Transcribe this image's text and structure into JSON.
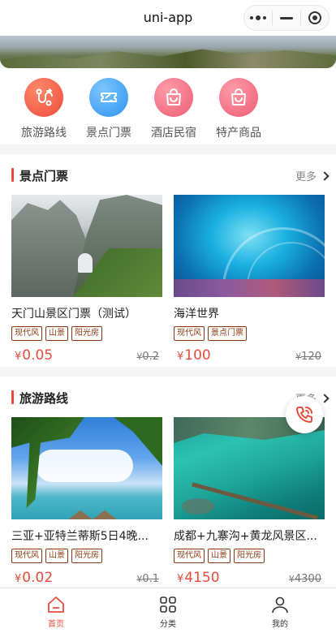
{
  "navbar": {
    "title": "uni-app"
  },
  "quick_links": [
    {
      "label": "旅游路线",
      "icon": "route-icon",
      "color": "#f0574a"
    },
    {
      "label": "景点门票",
      "icon": "ticket-icon",
      "color": "#3ea2f5"
    },
    {
      "label": "酒店民宿",
      "icon": "bag-icon",
      "color": "#f06478"
    },
    {
      "label": "特产商品",
      "icon": "bag-icon",
      "color": "#f06478"
    }
  ],
  "sections": [
    {
      "title": "景点门票",
      "more": "更多",
      "items": [
        {
          "name": "天门山景区门票（测试）",
          "tags": [
            "现代风",
            "山景",
            "阳光房"
          ],
          "currency": "¥",
          "price": "0.05",
          "orig": "0.2"
        },
        {
          "name": "海洋世界",
          "tags": [
            "现代风",
            "景点门票"
          ],
          "currency": "¥",
          "price": "100",
          "orig": "120"
        }
      ]
    },
    {
      "title": "旅游路线",
      "more": "更多",
      "items": [
        {
          "name": "三亚+亚特兰蒂斯5日4晚...",
          "tags": [
            "现代风",
            "山景",
            "阳光房"
          ],
          "currency": "¥",
          "price": "0.02",
          "orig": "0.1"
        },
        {
          "name": "成都+九寨沟+黄龙风景区...",
          "tags": [
            "现代风",
            "山景",
            "阳光房"
          ],
          "currency": "¥",
          "price": "4150",
          "orig": "4300"
        }
      ]
    }
  ],
  "tabbar": [
    {
      "label": "首页",
      "icon": "home-icon",
      "active": true
    },
    {
      "label": "分类",
      "icon": "category-icon",
      "active": false
    },
    {
      "label": "我的",
      "icon": "user-icon",
      "active": false
    }
  ],
  "colors": {
    "accent": "#e84b3c",
    "tag": "#8a3a12"
  }
}
